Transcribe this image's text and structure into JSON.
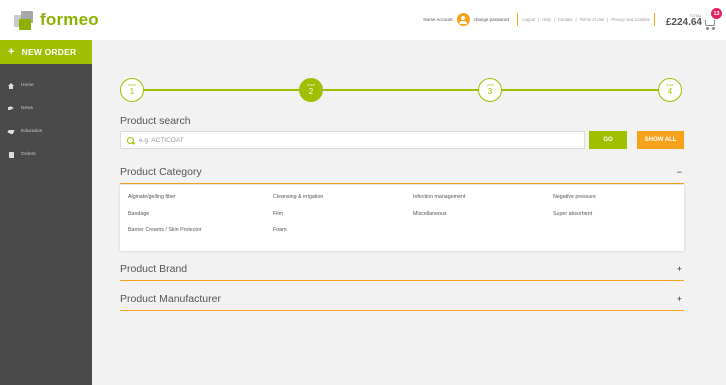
{
  "header": {
    "logo_text": "formeo",
    "account_name": "Nurse Account",
    "change_password": "change password",
    "links": [
      "Logout",
      "|",
      "Help",
      "|",
      "Contact",
      "|",
      "Terms of Use",
      "|",
      "Privacy and Cookies"
    ],
    "total_label": "TOTAL",
    "total_value": "£224.64",
    "cart_count": "13"
  },
  "sidebar": {
    "new_order": "NEW ORDER",
    "new_order_icon": "plus-icon",
    "items": [
      {
        "label": "Home",
        "icon": "home-icon"
      },
      {
        "label": "News",
        "icon": "megaphone-icon"
      },
      {
        "label": "Education",
        "icon": "graduation-cap-icon"
      },
      {
        "label": "Orders",
        "icon": "clipboard-icon"
      }
    ]
  },
  "steps": [
    {
      "label": "STEP",
      "number": "1"
    },
    {
      "label": "STEP",
      "number": "2"
    },
    {
      "label": "STEP",
      "number": "3"
    },
    {
      "label": "STEP",
      "number": "4"
    }
  ],
  "active_step": 2,
  "search": {
    "title": "Product search",
    "placeholder": "e.g. ACTICOAT",
    "go": "GO",
    "show_all": "SHOW ALL"
  },
  "category": {
    "title": "Product Category",
    "toggle": "−",
    "items": [
      "Alginate/gelling fiber",
      "Cleansing & irrigation",
      "Infection management",
      "Negative pressure",
      "Bandage",
      "Film",
      "Miscellaneous",
      "Super absorbent",
      "Barrier Creams / Skin Protector",
      "Foam"
    ]
  },
  "brand": {
    "title": "Product Brand",
    "toggle": "+"
  },
  "manufacturer": {
    "title": "Product Manufacturer",
    "toggle": "+"
  },
  "colors": {
    "brand_green": "#9fbf00",
    "accent_orange": "#f7a21b",
    "sidebar_bg": "#4a4a4a",
    "badge_pink": "#e0245e"
  }
}
